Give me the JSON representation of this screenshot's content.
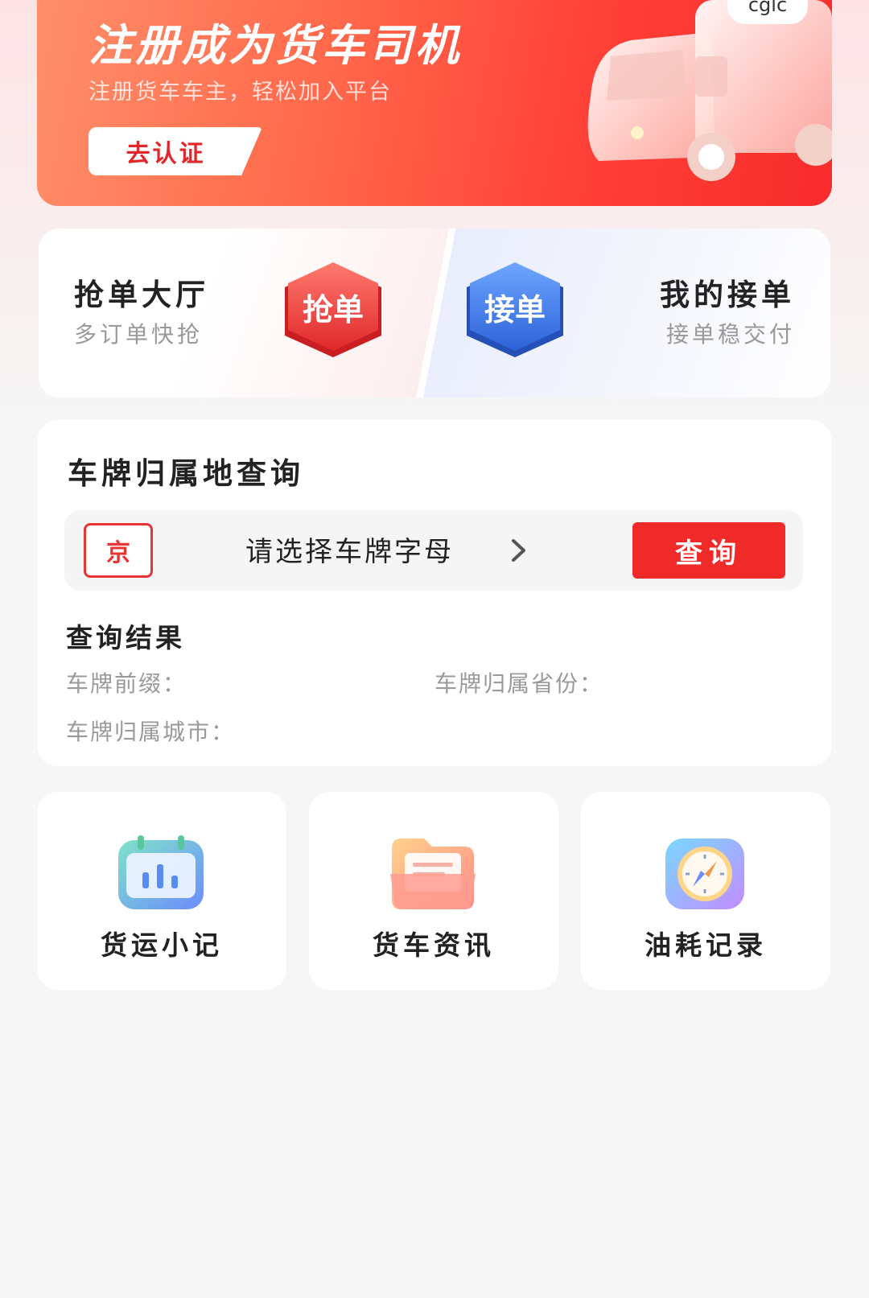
{
  "banner": {
    "title": "注册成为货车司机",
    "subtitle": "注册货车车主，轻松加入平台",
    "button_label": "去认证",
    "truck_badge": "cglc"
  },
  "cards": {
    "grab": {
      "title": "抢单大厅",
      "subtitle": "多订单快抢",
      "badge": "抢单"
    },
    "mine": {
      "title": "我的接单",
      "subtitle": "接单稳交付",
      "badge": "接单"
    }
  },
  "plate_query": {
    "title": "车牌归属地查询",
    "province": "京",
    "letter_placeholder": "请选择车牌字母",
    "query_button": "查询",
    "result_title": "查询结果",
    "labels": {
      "prefix": "车牌前缀：",
      "province": "车牌归属省份：",
      "city": "车牌归属城市："
    }
  },
  "tools": [
    {
      "label": "货运小记",
      "icon": "calendar-chart-icon"
    },
    {
      "label": "货车资讯",
      "icon": "folder-icon"
    },
    {
      "label": "油耗记录",
      "icon": "compass-icon"
    }
  ],
  "colors": {
    "accent_red": "#f02a28",
    "blue_badge": "#3b78e7"
  }
}
